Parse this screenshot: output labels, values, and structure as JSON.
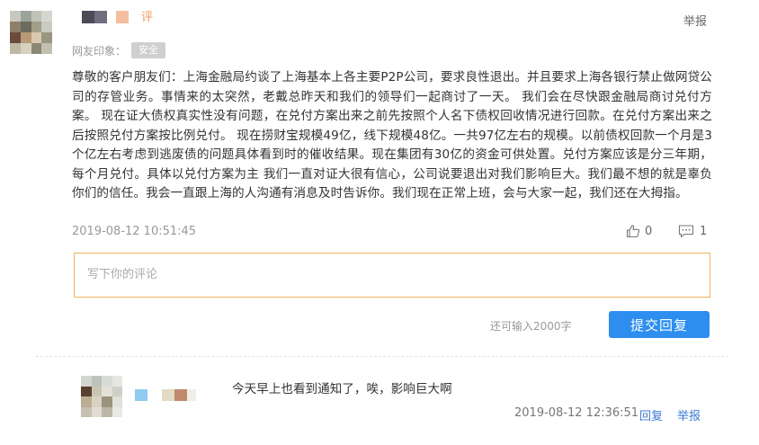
{
  "comment": {
    "name_suffix": "评",
    "report_label": "举报",
    "impression_label": "网友印象：",
    "impression_badge": "安全",
    "body": "尊敬的客户朋友们：上海金融局约谈了上海基本上各主要P2P公司，要求良性退出。并且要求上海各银行禁止做网贷公司的存管业务。事情来的太突然，老戴总昨天和我们的领导们一起商讨了一天。 我们会在尽快跟金融局商讨兑付方案。 现在证大债权真实性没有问题，在兑付方案出来之前先按照个人名下债权回收情况进行回款。在兑付方案出来之后按照兑付方案按比例兑付。 现在捞财宝规模49亿，线下规模48亿。一共97亿左右的规模。以前债权回款一个月是3个亿左右考虑到逃废债的问题具体看到时的催收结果。现在集团有30亿的资金可供处置。兑付方案应该是分三年期，每个月兑付。具体以兑付方案为主 我们一直对证大很有信心，公司说要退出对我们影响巨大。我们最不想的就是辜负你们的信任。我会一直跟上海的人沟通有消息及时告诉你。我们现在正常上班，会与大家一起，我们还在大拇指。",
    "timestamp": "2019-08-12 10:51:45",
    "like_count": "0",
    "reply_count": "1",
    "like_icon": "thumbs-up-icon",
    "reply_icon": "comment-bubble-icon"
  },
  "reply_form": {
    "placeholder": "写下你的评论",
    "char_left": "还可输入2000字",
    "submit_label": "提交回复"
  },
  "reply": {
    "text": "今天早上也看到通知了，唉，影响巨大啊",
    "timestamp": "2019-08-12 12:36:51",
    "reply_label": "回复",
    "report_label": "举报"
  },
  "colors": {
    "accent_blue": "#2d8ef0",
    "link_blue": "#3c7bd6",
    "name_orange": "#f39a5c",
    "input_border": "#f0b35d"
  }
}
